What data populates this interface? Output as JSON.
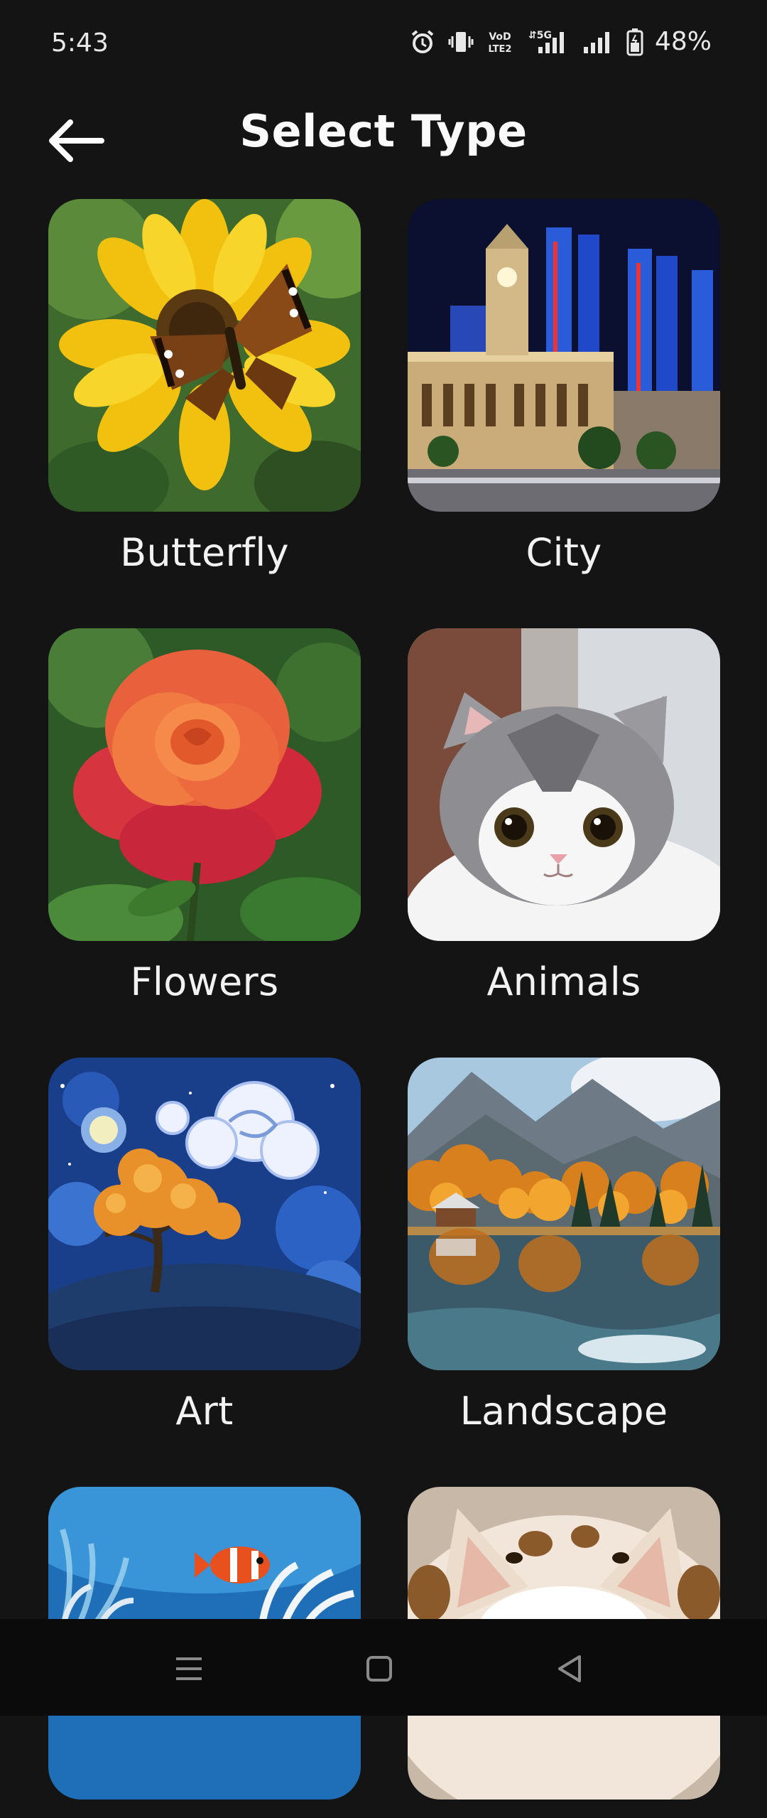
{
  "status_bar": {
    "time": "5:43",
    "battery": "48%",
    "icons": [
      "alarm-icon",
      "vibrate-icon",
      "volte-icon",
      "signal-5g-icon",
      "signal-icon",
      "battery-icon"
    ]
  },
  "header": {
    "title": "Select Type",
    "back_icon": "arrow-left-icon"
  },
  "categories": [
    {
      "label": "Butterfly"
    },
    {
      "label": "City"
    },
    {
      "label": "Flowers"
    },
    {
      "label": "Animals"
    },
    {
      "label": "Art"
    },
    {
      "label": "Landscape"
    },
    {
      "label": ""
    },
    {
      "label": ""
    }
  ],
  "nav_bar": {
    "icons": [
      "menu-icon",
      "home-square-icon",
      "back-triangle-icon"
    ]
  },
  "colors": {
    "background": "#141414",
    "nav_background": "#0b0b0b",
    "text": "#ffffff"
  }
}
